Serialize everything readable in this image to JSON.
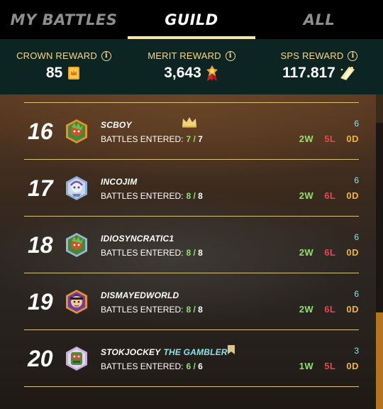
{
  "tabs": [
    {
      "label": "MY BATTLES",
      "active": false
    },
    {
      "label": "GUILD",
      "active": true
    },
    {
      "label": "ALL",
      "active": false
    }
  ],
  "rewards": [
    {
      "label": "CROWN REWARD",
      "value": "85",
      "icon": "crown-token-icon"
    },
    {
      "label": "MERIT REWARD",
      "value": "3,643",
      "icon": "merit-medal-icon"
    },
    {
      "label": "SPS REWARD",
      "value": "117.817",
      "icon": "sps-token-icon"
    }
  ],
  "entered_label": "BATTLES ENTERED:",
  "players": [
    {
      "rank": "16",
      "name": "SCBOY",
      "title": "",
      "entered": "7",
      "total": "7",
      "score": "6",
      "wins": "2W",
      "losses": "5L",
      "draws": "0D",
      "badge": "crown"
    },
    {
      "rank": "17",
      "name": "INCOJIM",
      "title": "",
      "entered": "8",
      "total": "8",
      "score": "6",
      "wins": "2W",
      "losses": "6L",
      "draws": "0D",
      "badge": ""
    },
    {
      "rank": "18",
      "name": "IDIOSYNCRATIC1",
      "title": "",
      "entered": "8",
      "total": "8",
      "score": "6",
      "wins": "2W",
      "losses": "6L",
      "draws": "0D",
      "badge": ""
    },
    {
      "rank": "19",
      "name": "DISMAYEDWORLD",
      "title": "",
      "entered": "8",
      "total": "8",
      "score": "6",
      "wins": "2W",
      "losses": "6L",
      "draws": "0D",
      "badge": ""
    },
    {
      "rank": "20",
      "name": "STOKJOCKEY",
      "title": "THE GAMBLER",
      "entered": "6",
      "total": "6",
      "score": "3",
      "wins": "1W",
      "losses": "5L",
      "draws": "0D",
      "badge": "flag"
    }
  ],
  "colors": {
    "accent": "#f7e7a6",
    "gold": "#f4d88e",
    "win": "#8fe26a",
    "loss": "#e9474d",
    "draw": "#f0b52d",
    "score": "#8ee3e6"
  }
}
